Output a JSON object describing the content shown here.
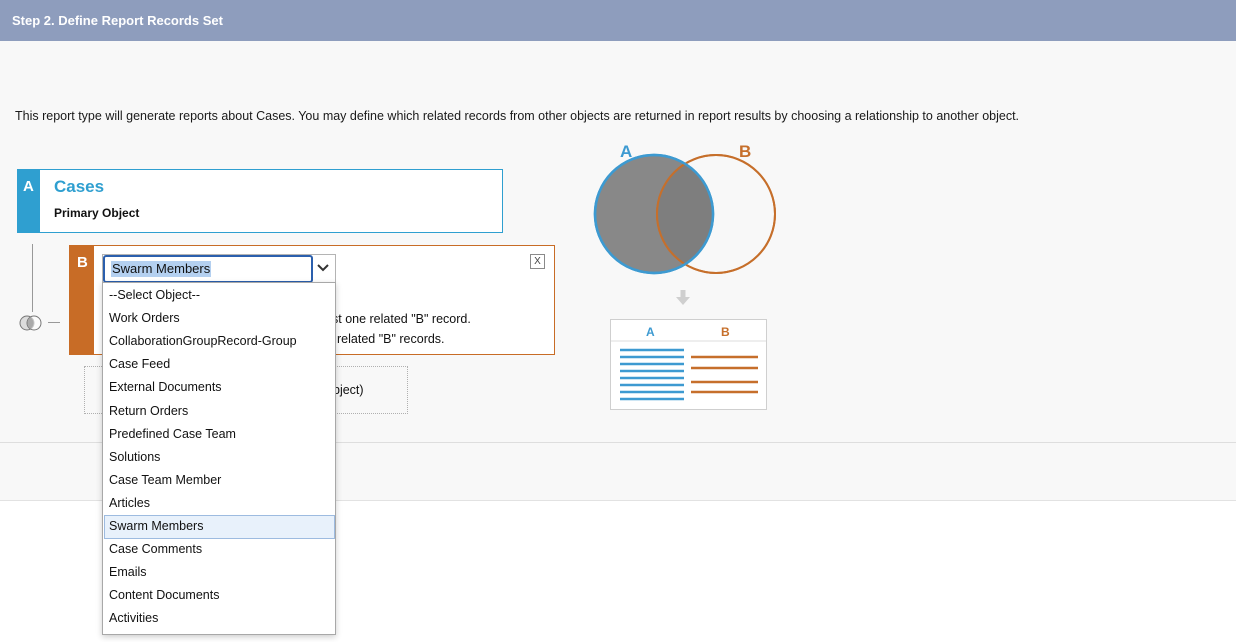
{
  "header": {
    "title": "Step 2. Define Report Records Set"
  },
  "intro": "This report type will generate reports about Cases. You may define which related records from other objects are returned in report results by choosing a relationship to another object.",
  "object_a": {
    "letter": "A",
    "name": "Cases",
    "subtitle": "Primary Object"
  },
  "object_b": {
    "letter": "B",
    "close_label": "X",
    "selected_value": "Swarm Members",
    "line1": "st one related \"B\" record.",
    "line2": "related \"B\" records."
  },
  "add_object_text": "bject)",
  "dropdown": {
    "options": [
      "--Select Object--",
      "Work Orders",
      "CollaborationGroupRecord-Group",
      "Case Feed",
      "External Documents",
      "Return Orders",
      "Predefined Case Team",
      "Solutions",
      "Case Team Member",
      "Articles",
      "Swarm Members",
      "Case Comments",
      "Emails",
      "Content Documents",
      "Activities"
    ],
    "highlighted": "Swarm Members"
  },
  "venn": {
    "label_a": "A",
    "label_b": "B",
    "color_a": "#3d9ad1",
    "color_b": "#c66f2b"
  },
  "result_table": {
    "col_a": "A",
    "col_b": "B"
  },
  "icons": {
    "join": "join-icon",
    "close": "close-icon",
    "arrow": "chevron-down-icon",
    "down": "down-arrow-icon"
  }
}
